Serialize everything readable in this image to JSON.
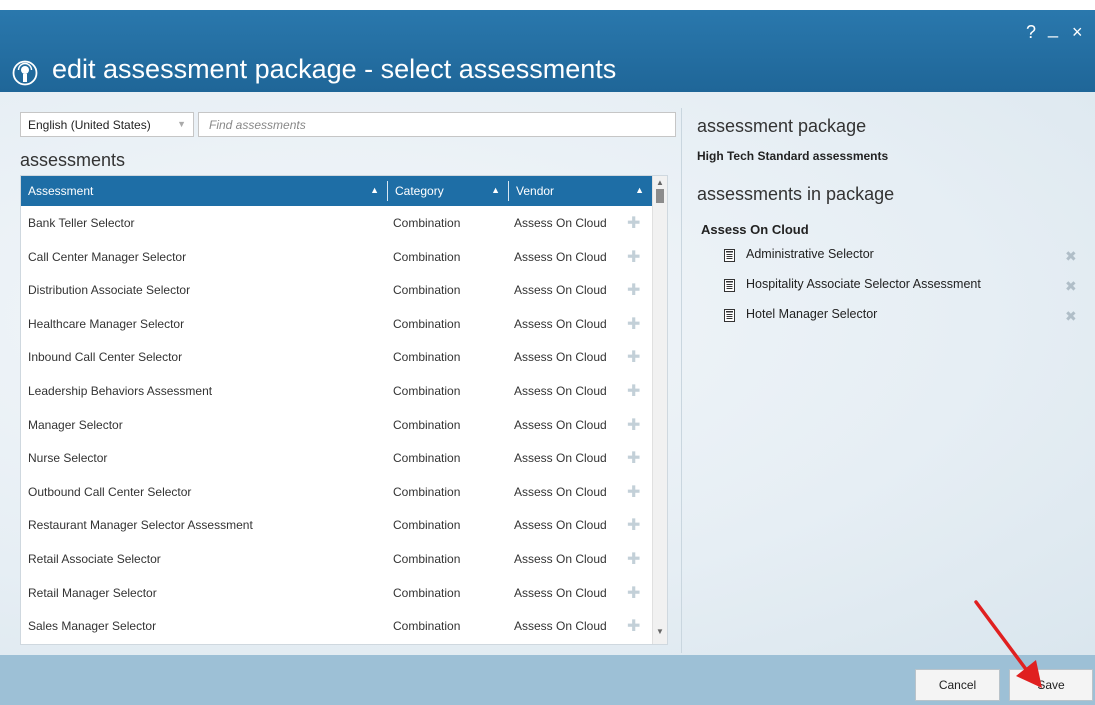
{
  "window": {
    "title": "edit assessment package - select assessments",
    "help_icon": "?",
    "minimize_icon": "_",
    "close_icon": "×"
  },
  "filters": {
    "language": "English (United States)",
    "search_placeholder": "Find assessments"
  },
  "assessments_section": {
    "title": "assessments",
    "columns": [
      "Assessment",
      "Category",
      "Vendor"
    ],
    "rows": [
      {
        "assessment": "Bank Teller Selector",
        "category": "Combination",
        "vendor": "Assess On Cloud"
      },
      {
        "assessment": "Call Center Manager Selector",
        "category": "Combination",
        "vendor": "Assess On Cloud"
      },
      {
        "assessment": "Distribution Associate Selector",
        "category": "Combination",
        "vendor": "Assess On Cloud"
      },
      {
        "assessment": "Healthcare Manager Selector",
        "category": "Combination",
        "vendor": "Assess On Cloud"
      },
      {
        "assessment": "Inbound Call Center Selector",
        "category": "Combination",
        "vendor": "Assess On Cloud"
      },
      {
        "assessment": "Leadership Behaviors Assessment",
        "category": "Combination",
        "vendor": "Assess On Cloud"
      },
      {
        "assessment": "Manager Selector",
        "category": "Combination",
        "vendor": "Assess On Cloud"
      },
      {
        "assessment": "Nurse Selector",
        "category": "Combination",
        "vendor": "Assess On Cloud"
      },
      {
        "assessment": "Outbound Call Center Selector",
        "category": "Combination",
        "vendor": "Assess On Cloud"
      },
      {
        "assessment": "Restaurant Manager Selector Assessment",
        "category": "Combination",
        "vendor": "Assess On Cloud"
      },
      {
        "assessment": "Retail Associate Selector",
        "category": "Combination",
        "vendor": "Assess On Cloud"
      },
      {
        "assessment": "Retail Manager Selector",
        "category": "Combination",
        "vendor": "Assess On Cloud"
      },
      {
        "assessment": "Sales Manager Selector",
        "category": "Combination",
        "vendor": "Assess On Cloud"
      }
    ]
  },
  "package_section": {
    "title": "assessment package",
    "package_name": "High Tech Standard assessments",
    "in_package_title": "assessments in package",
    "vendor": "Assess On Cloud",
    "items": [
      "Administrative Selector",
      "Hospitality Associate Selector Assessment",
      "Hotel Manager Selector"
    ]
  },
  "footer": {
    "cancel_label": "Cancel",
    "save_label": "Save"
  },
  "colors": {
    "titlebar": "#1f6698",
    "grid_header": "#1e6ea6",
    "footer": "#9dc0d6",
    "annotation_arrow": "#e02020"
  }
}
